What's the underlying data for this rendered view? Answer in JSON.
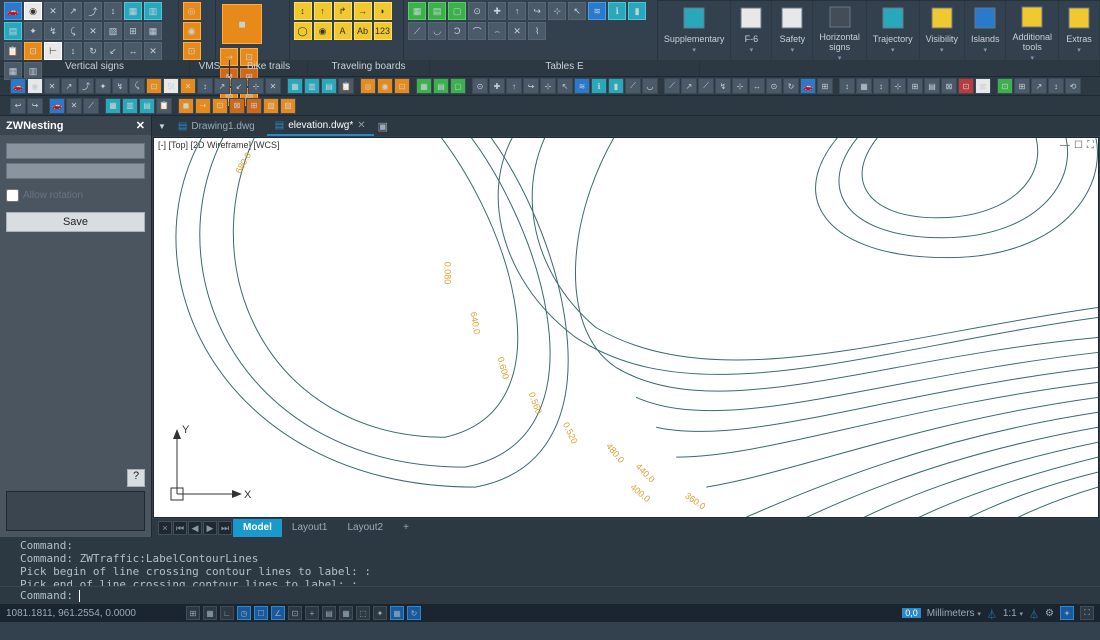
{
  "ribbon": {
    "labels": [
      "Vertical signs",
      "VMS",
      "Bike trails",
      "Traveling boards",
      "Tables E"
    ],
    "big_buttons": [
      {
        "label": "Supplementary",
        "color": "cyan"
      },
      {
        "label": "F-6",
        "color": "white"
      },
      {
        "label": "Safety",
        "color": "white"
      },
      {
        "label": "Horizontal\nsigns",
        "color": "dark"
      },
      {
        "label": "Trajectory",
        "color": "cyan"
      },
      {
        "label": "Visibility",
        "color": "yellow"
      },
      {
        "label": "Islands",
        "color": "blue"
      },
      {
        "label": "Additional\ntools",
        "color": "yellow"
      },
      {
        "label": "Extras",
        "color": "yellow"
      }
    ]
  },
  "sidepanel": {
    "title": "ZWNesting",
    "allow_rotation": "Allow rotation",
    "save": "Save",
    "help": "?"
  },
  "doc_tabs": [
    {
      "name": "Drawing1.dwg",
      "active": false
    },
    {
      "name": "elevation.dwg*",
      "active": true
    }
  ],
  "canvas": {
    "header": "[-] [Top] [2D Wireframe] [WCS]",
    "ctrl_min": "—",
    "ctrl_sq": "☐",
    "ctrl_max": "⛶",
    "y_label": "Y",
    "x_label": "X",
    "contour_labels": [
      "680.0",
      "0.080",
      "640.0",
      "0.600",
      "0.560",
      "0.520",
      "480.0",
      "440.0",
      "400.0",
      "360.0"
    ]
  },
  "model_tabs": {
    "x": "×",
    "first": "⏮",
    "prev": "◀",
    "next": "▶",
    "last": "⏭",
    "tabs": [
      "Model",
      "Layout1",
      "Layout2"
    ],
    "add": "+"
  },
  "command": {
    "log": "Command:\nCommand: ZWTraffic:LabelContourLines\nPick begin of line crossing contour lines to label: :\nPick end of line crossing contour lines to label: :",
    "prompt": "Command: "
  },
  "statusbar": {
    "coords": "1081.1811, 961.2554, 0.0000",
    "units_badge": "0,0",
    "units": "Millimeters",
    "scale": "1:1",
    "settings": "⚙"
  }
}
